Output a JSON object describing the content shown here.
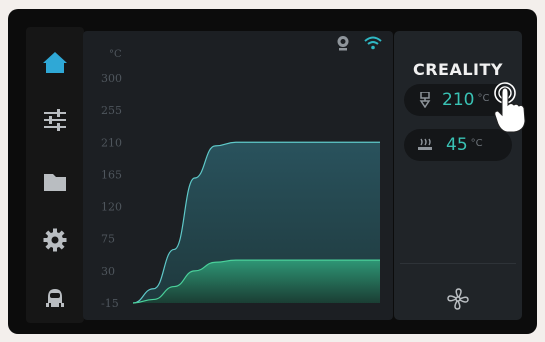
{
  "brand": "CREALITY",
  "nozzle": {
    "value": "210",
    "unit": "°C"
  },
  "bed": {
    "value": "45",
    "unit": "°C"
  },
  "icons": {
    "sidebar": [
      "home-icon",
      "settings-sliders-icon",
      "folder-icon",
      "gear-icon",
      "robot-icon"
    ],
    "status": [
      "camera-icon",
      "wifi-icon"
    ],
    "panel": [
      "nozzle-temperature-icon",
      "bed-temperature-icon",
      "fan-icon",
      "pointing-hand-cursor-icon"
    ]
  },
  "colors": {
    "accent": "#2fa8d6",
    "nozzle_curve": "#5fc9c9",
    "bed_curve": "#4ad09a",
    "value_text": "#39c2b4"
  },
  "chart_data": {
    "type": "area",
    "ylabel": "°C",
    "y_ticks": [
      "300",
      "255",
      "210",
      "165",
      "120",
      "75",
      "30",
      "-15"
    ],
    "ylim": [
      -15,
      300
    ],
    "grid": false,
    "series": [
      {
        "values": [
          -15,
          5,
          60,
          160,
          205,
          210,
          210,
          210,
          210,
          210,
          210,
          210,
          210
        ]
      },
      {
        "values": [
          -15,
          -10,
          8,
          30,
          42,
          45,
          45,
          45,
          45,
          45,
          45,
          45,
          45
        ]
      }
    ]
  }
}
